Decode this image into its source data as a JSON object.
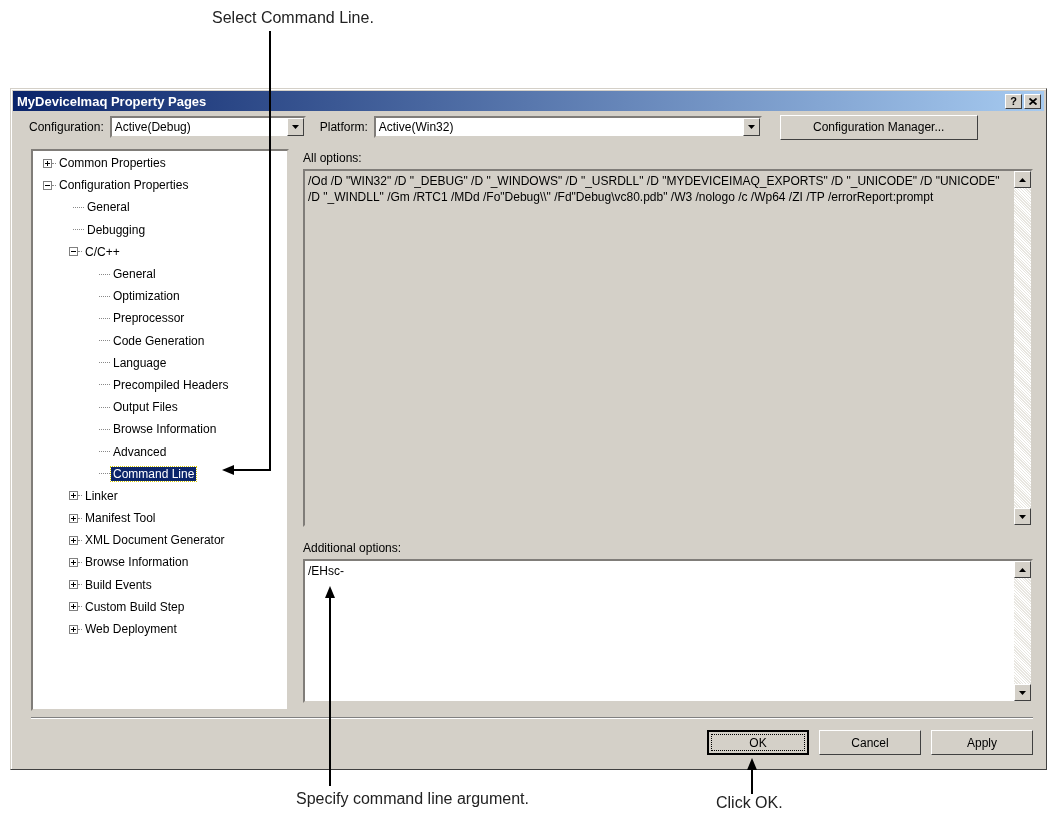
{
  "callouts": {
    "top": "Select Command Line.",
    "bottom_left": "Specify command line argument.",
    "bottom_right": "Click OK."
  },
  "window": {
    "title": "MyDeviceImaq Property Pages",
    "help": "?"
  },
  "configuration": {
    "label": "Configuration:",
    "value": "Active(Debug)"
  },
  "platform": {
    "label": "Platform:",
    "value": "Active(Win32)"
  },
  "configuration_manager_button": "Configuration Manager...",
  "tree": [
    {
      "label": "Common Properties",
      "expanded": false,
      "selected": false
    },
    {
      "label": "Configuration Properties",
      "expanded": true,
      "selected": false,
      "children": [
        {
          "label": "General",
          "selected": false
        },
        {
          "label": "Debugging",
          "selected": false
        },
        {
          "label": "C/C++",
          "expanded": true,
          "selected": false,
          "children": [
            {
              "label": "General",
              "selected": false
            },
            {
              "label": "Optimization",
              "selected": false
            },
            {
              "label": "Preprocessor",
              "selected": false
            },
            {
              "label": "Code Generation",
              "selected": false
            },
            {
              "label": "Language",
              "selected": false
            },
            {
              "label": "Precompiled Headers",
              "selected": false
            },
            {
              "label": "Output Files",
              "selected": false
            },
            {
              "label": "Browse Information",
              "selected": false
            },
            {
              "label": "Advanced",
              "selected": false
            },
            {
              "label": "Command Line",
              "selected": true
            }
          ]
        },
        {
          "label": "Linker",
          "expanded": false,
          "selected": false
        },
        {
          "label": "Manifest Tool",
          "expanded": false,
          "selected": false
        },
        {
          "label": "XML Document Generator",
          "expanded": false,
          "selected": false
        },
        {
          "label": "Browse Information",
          "expanded": false,
          "selected": false
        },
        {
          "label": "Build Events",
          "expanded": false,
          "selected": false
        },
        {
          "label": "Custom Build Step",
          "expanded": false,
          "selected": false
        },
        {
          "label": "Web Deployment",
          "expanded": false,
          "selected": false
        }
      ]
    }
  ],
  "all_options": {
    "label": "All options:",
    "value": "/Od /D \"WIN32\" /D \"_DEBUG\" /D \"_WINDOWS\" /D \"_USRDLL\" /D \"MYDEVICEIMAQ_EXPORTS\" /D \"_UNICODE\" /D \"UNICODE\" /D \"_WINDLL\" /Gm /RTC1 /MDd /Fo\"Debug\\\\\" /Fd\"Debug\\vc80.pdb\" /W3 /nologo /c /Wp64 /ZI /TP /errorReport:prompt"
  },
  "additional_options": {
    "label": "Additional options:",
    "value": "/EHsc-"
  },
  "buttons": [
    {
      "label": "OK",
      "default": true
    },
    {
      "label": "Cancel",
      "default": false
    },
    {
      "label": "Apply",
      "default": false
    }
  ]
}
